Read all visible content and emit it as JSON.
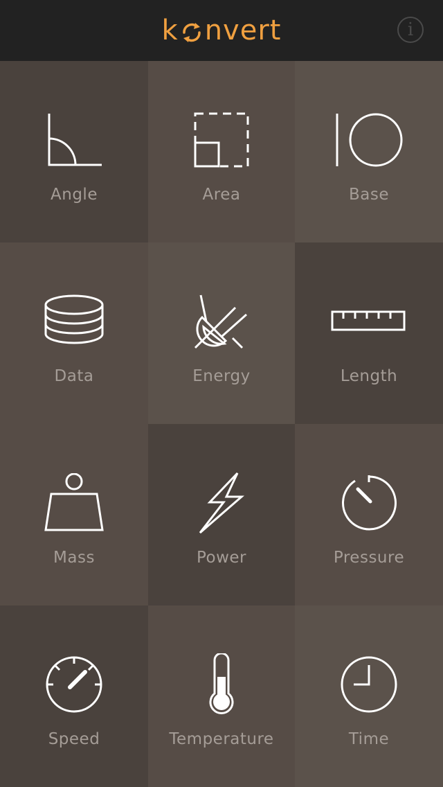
{
  "header": {
    "logo_text_before": "k",
    "logo_text_after": "nvert",
    "logo_full": "konvert",
    "info_icon": "info-icon",
    "info_symbol": "i"
  },
  "colors": {
    "topbar": "#222222",
    "accent": "#f0a040",
    "label": "#a59d97",
    "tile_dark": "#4a423d",
    "tile_mid": "#564c46",
    "tile_light": "#5b524b"
  },
  "categories": [
    {
      "label": "Angle",
      "icon": "angle-icon"
    },
    {
      "label": "Area",
      "icon": "area-icon"
    },
    {
      "label": "Base",
      "icon": "base-icon"
    },
    {
      "label": "Data",
      "icon": "data-icon"
    },
    {
      "label": "Energy",
      "icon": "energy-icon"
    },
    {
      "label": "Length",
      "icon": "length-icon"
    },
    {
      "label": "Mass",
      "icon": "mass-icon"
    },
    {
      "label": "Power",
      "icon": "power-icon"
    },
    {
      "label": "Pressure",
      "icon": "pressure-icon"
    },
    {
      "label": "Speed",
      "icon": "speed-icon"
    },
    {
      "label": "Temperature",
      "icon": "temperature-icon"
    },
    {
      "label": "Time",
      "icon": "time-icon"
    }
  ]
}
